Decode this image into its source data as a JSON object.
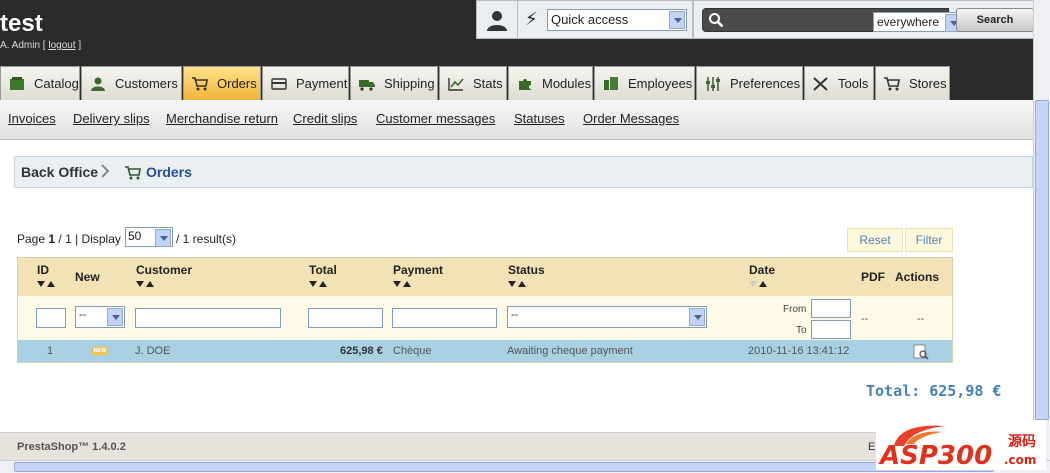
{
  "header": {
    "shop_name": "test",
    "admin_prefix": "A. Admin [",
    "logout_label": "logout",
    "admin_suffix": "]",
    "quick_access": "Quick access",
    "search_scope": "everywhere",
    "search_button": "Search",
    "search_value": ""
  },
  "tabs": [
    {
      "label": "Catalog",
      "icon": "catalog-icon"
    },
    {
      "label": "Customers",
      "icon": "customers-icon"
    },
    {
      "label": "Orders",
      "icon": "cart-icon",
      "active": true
    },
    {
      "label": "Payment",
      "icon": "payment-icon"
    },
    {
      "label": "Shipping",
      "icon": "truck-icon"
    },
    {
      "label": "Stats",
      "icon": "stats-icon"
    },
    {
      "label": "Modules",
      "icon": "puzzle-icon"
    },
    {
      "label": "Employees",
      "icon": "employees-icon"
    },
    {
      "label": "Preferences",
      "icon": "sliders-icon"
    },
    {
      "label": "Tools",
      "icon": "tools-icon"
    },
    {
      "label": "Stores",
      "icon": "cart-icon"
    }
  ],
  "submenu": [
    "Invoices",
    "Delivery slips",
    "Merchandise return",
    "Credit slips",
    "Customer messages",
    "Statuses",
    "Order Messages"
  ],
  "breadcrumb": {
    "home": "Back Office",
    "current": "Orders"
  },
  "paging": {
    "page_label": "Page",
    "page_current": "1",
    "page_total": "/ 1",
    "display_label": "| Display",
    "display_value": "50",
    "results": "/ 1 result(s)",
    "reset_label": "Reset",
    "filter_label": "Filter"
  },
  "table": {
    "headers": {
      "id": "ID",
      "new": "New",
      "customer": "Customer",
      "total": "Total",
      "payment": "Payment",
      "status": "Status",
      "date": "Date",
      "pdf": "PDF",
      "actions": "Actions"
    },
    "filters": {
      "new_select": "--",
      "status_select": "--",
      "from_label": "From",
      "to_label": "To",
      "pdf_dash": "--",
      "actions_dash": "--"
    },
    "rows": [
      {
        "id": "1",
        "new_badge": "NEW",
        "customer": "J. DOE",
        "total": "625,98 €",
        "payment": "Chèque",
        "status": "Awaiting cheque payment",
        "date": "2010-11-16 13:41:12"
      }
    ]
  },
  "grand_total": "Total: 625,98 €",
  "footer": {
    "version": "PrestaShop™ 1.4.0.2",
    "right_initial": "E"
  },
  "watermark": {
    "text": "ASP300",
    "sub": "源码",
    "domain": ".com"
  },
  "colors": {
    "accent_blue": "#4383b8",
    "active_tab": "#f2b437",
    "row_highlight": "#a9d1e3",
    "header_bg": "#2a2a2a"
  }
}
